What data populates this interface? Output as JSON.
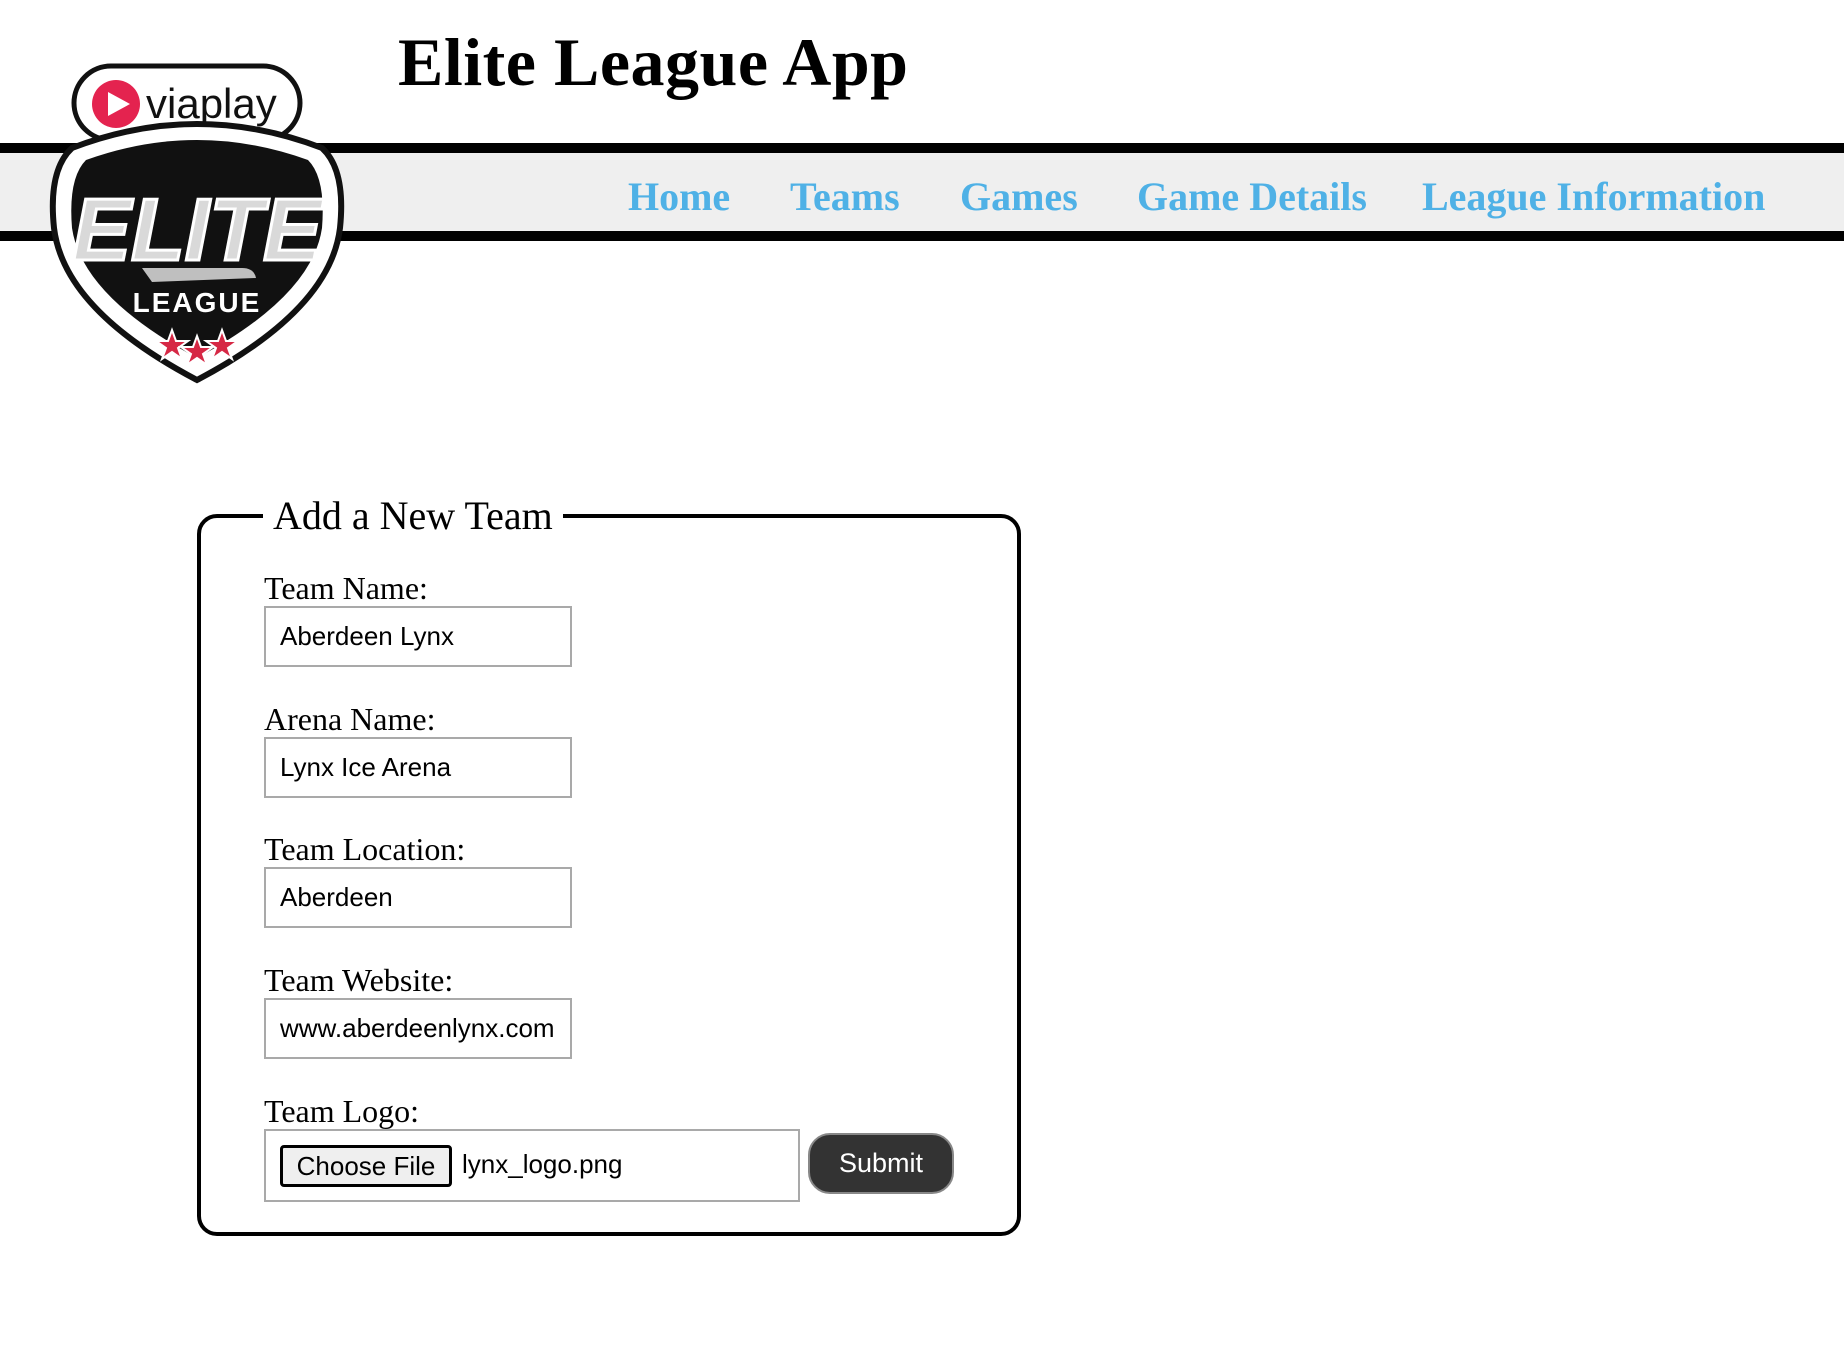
{
  "header": {
    "title": "Elite League App"
  },
  "logo": {
    "brand_text": "viaplay",
    "main_text": "ELITE",
    "sub_text": "LEAGUE",
    "colors": {
      "brand_red": "#e4234f",
      "brand_purple": "#8b2a8c",
      "star_red": "#d62845",
      "shield_black": "#111111",
      "silver": "#c9c9c9"
    }
  },
  "nav": {
    "color": "#4fb1e6",
    "items": [
      {
        "label": "Home"
      },
      {
        "label": "Teams"
      },
      {
        "label": "Games"
      },
      {
        "label": "Game Details"
      },
      {
        "label": "League Information"
      }
    ]
  },
  "form": {
    "legend": "Add a New Team",
    "fields": {
      "team_name": {
        "label": "Team Name:",
        "value": "Aberdeen Lynx"
      },
      "arena_name": {
        "label": "Arena Name:",
        "value": "Lynx Ice Arena"
      },
      "team_location": {
        "label": "Team Location:",
        "value": "Aberdeen"
      },
      "team_website": {
        "label": "Team Website:",
        "value": "www.aberdeenlynx.com"
      },
      "team_logo": {
        "label": "Team Logo:",
        "button_label": "Choose File",
        "file_name": "lynx_logo.png"
      }
    },
    "submit_label": "Submit"
  }
}
